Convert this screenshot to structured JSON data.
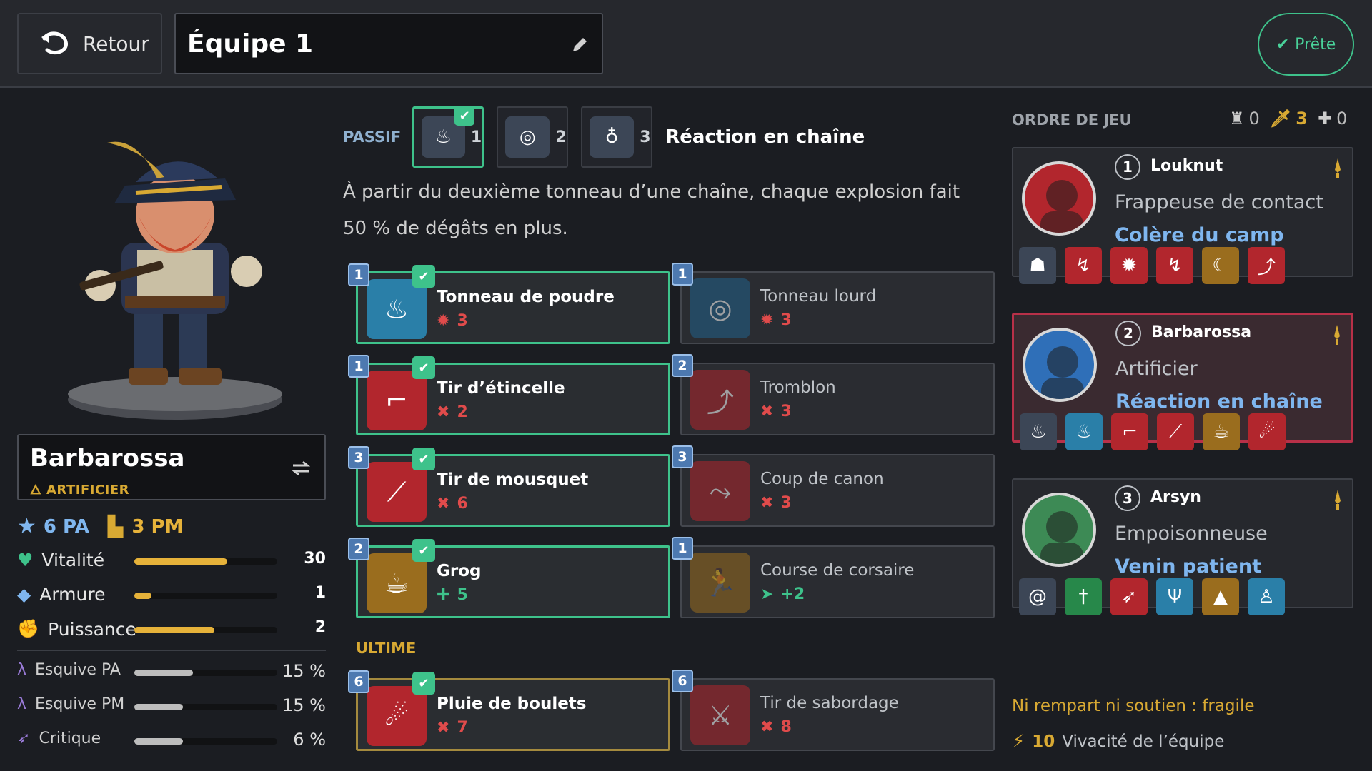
{
  "header": {
    "back_label": "Retour",
    "team_name": "Équipe 1",
    "ready_label": "Prête"
  },
  "character": {
    "name": "Barbarossa",
    "class": "ARTIFICIER",
    "pa": "6 PA",
    "pm": "3 PM",
    "stats": [
      {
        "label": "Vitalité",
        "value": "30",
        "level": 0.65,
        "color": "#e6b23a"
      },
      {
        "label": "Armure",
        "value": "1",
        "level": 0.12,
        "color": "#e6b23a"
      },
      {
        "label": "Puissance",
        "value": "2",
        "level": 0.56,
        "color": "#e6b23a"
      }
    ],
    "secondary": [
      {
        "label": "Esquive PA",
        "value": "15 %",
        "level": 0.41
      },
      {
        "label": "Esquive PM",
        "value": "15 %",
        "level": 0.34
      },
      {
        "label": "Critique",
        "value": "6 %",
        "level": 0.34
      }
    ]
  },
  "passive": {
    "label": "PASSIF",
    "slots": [
      {
        "num": "1",
        "icon": "candles-icon",
        "selected": true
      },
      {
        "num": "2",
        "icon": "barrel-icon",
        "selected": false
      },
      {
        "num": "3",
        "icon": "fuse-icon",
        "selected": false
      }
    ],
    "name": "Réaction en chaîne",
    "description": "À partir du deuxième tonneau d’une chaîne, chaque explosion fait 50 % de dégâts en plus."
  },
  "spells": [
    {
      "name": "Tonneau de poudre",
      "value": "3",
      "cost": "1",
      "selected": true,
      "icon": "barrel-bomb-icon",
      "stat_icon": "explosion-icon",
      "color": "blue",
      "stat_color": "#e04b4b"
    },
    {
      "name": "Tonneau lourd",
      "value": "3",
      "cost": "1",
      "selected": false,
      "icon": "heavy-barrel-icon",
      "stat_icon": "explosion-icon",
      "color": "dblue",
      "stat_color": "#e04b4b"
    },
    {
      "name": "Tir d’étincelle",
      "value": "2",
      "cost": "1",
      "selected": true,
      "icon": "pistol-icon",
      "stat_icon": "damage-icon",
      "color": "red",
      "stat_color": "#e04b4b"
    },
    {
      "name": "Tromblon",
      "value": "3",
      "cost": "2",
      "selected": false,
      "icon": "blunderbuss-icon",
      "stat_icon": "damage-icon",
      "color": "red",
      "stat_color": "#e04b4b"
    },
    {
      "name": "Tir de mousquet",
      "value": "6",
      "cost": "3",
      "selected": true,
      "icon": "musket-icon",
      "stat_icon": "damage-icon",
      "color": "red",
      "stat_color": "#e04b4b"
    },
    {
      "name": "Coup de canon",
      "value": "3",
      "cost": "3",
      "selected": false,
      "icon": "cannon-icon",
      "stat_icon": "damage-icon",
      "color": "red",
      "stat_color": "#e04b4b"
    },
    {
      "name": "Grog",
      "value": "5",
      "cost": "2",
      "selected": true,
      "icon": "mug-icon",
      "stat_icon": "heal-icon",
      "color": "gold",
      "stat_color": "#3ec28b"
    },
    {
      "name": "Course de corsaire",
      "value": "+2",
      "cost": "1",
      "selected": false,
      "icon": "runner-icon",
      "stat_icon": "move-icon",
      "color": "gold",
      "stat_color": "#3ec28b"
    }
  ],
  "ultimate": {
    "label": "ULTIME",
    "spells": [
      {
        "name": "Pluie de boulets",
        "value": "7",
        "cost": "6",
        "selected": true,
        "icon": "cannonballs-icon",
        "color": "red",
        "stat_color": "#e04b4b"
      },
      {
        "name": "Tir de sabordage",
        "value": "8",
        "cost": "6",
        "selected": false,
        "icon": "scuttle-shot-icon",
        "color": "red",
        "stat_color": "#e04b4b"
      }
    ]
  },
  "order": {
    "title": "ORDRE DE JEU",
    "counts": {
      "tank": "0",
      "damage": "3",
      "support": "0"
    },
    "members": [
      {
        "num": "1",
        "name": "Louknut",
        "role": "Frappeuse de contact",
        "passive": "Colère du camp",
        "active": false,
        "spells": [
          [
            "tiger-icon",
            "steel"
          ],
          [
            "kick-icon",
            "red"
          ],
          [
            "burst-icon",
            "red"
          ],
          [
            "kick-icon",
            "red"
          ],
          [
            "horns-icon",
            "gold"
          ],
          [
            "leap-icon",
            "red"
          ]
        ]
      },
      {
        "num": "2",
        "name": "Barbarossa",
        "role": "Artificier",
        "passive": "Réaction en chaîne",
        "active": true,
        "spells": [
          [
            "candles-icon",
            "steel"
          ],
          [
            "barrel-bomb-icon",
            "blue"
          ],
          [
            "pistol-icon",
            "red"
          ],
          [
            "musket-icon",
            "red"
          ],
          [
            "mug-icon",
            "gold"
          ],
          [
            "cannonballs-icon",
            "red"
          ]
        ]
      },
      {
        "num": "3",
        "name": "Arsyn",
        "role": "Empoisonneuse",
        "passive": "Venin patient",
        "active": false,
        "spells": [
          [
            "swirl-icon",
            "steel"
          ],
          [
            "dagger-icon",
            "green"
          ],
          [
            "feather-icon",
            "red"
          ],
          [
            "trident-icon",
            "blue"
          ],
          [
            "hood-icon",
            "gold"
          ],
          [
            "figure-icon",
            "blue"
          ]
        ]
      }
    ]
  },
  "footer": {
    "warning": "Ni rempart ni soutien : fragile",
    "vivacity_value": "10",
    "vivacity_label": "Vivacité de l’équipe"
  }
}
